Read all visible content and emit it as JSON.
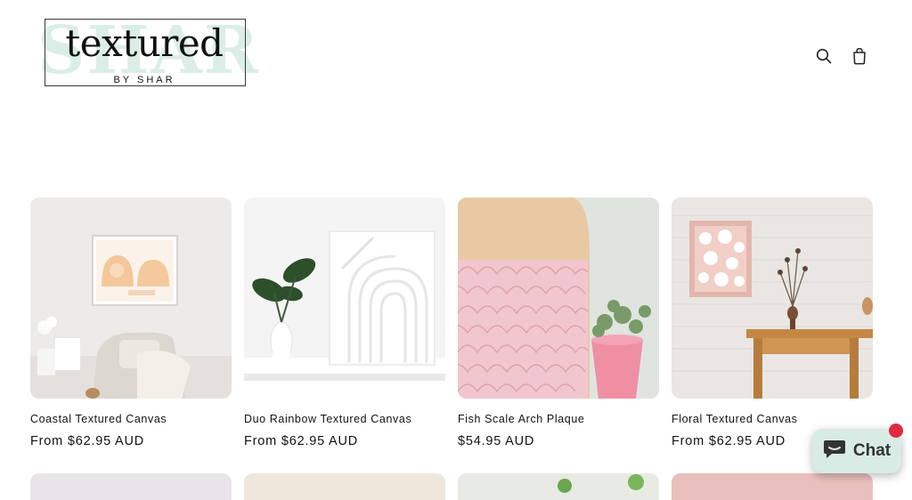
{
  "header": {
    "logo": {
      "bg_text": "SHAR",
      "main_text": "textured",
      "sub_text": "BY SHAR"
    },
    "icons": {
      "search": "search-icon",
      "cart": "cart-icon"
    }
  },
  "products": [
    {
      "title": "Coastal Textured Canvas",
      "price": "From $62.95 AUD"
    },
    {
      "title": "Duo Rainbow Textured Canvas",
      "price": "From $62.95 AUD"
    },
    {
      "title": "Fish Scale Arch Plaque",
      "price": "$54.95 AUD"
    },
    {
      "title": "Floral Textured Canvas",
      "price": "From $62.95 AUD"
    }
  ],
  "chat": {
    "label": "Chat",
    "icon": "chat-bubble-icon",
    "badge_color": "#e02a3f",
    "button_color": "#d9ebe5"
  }
}
